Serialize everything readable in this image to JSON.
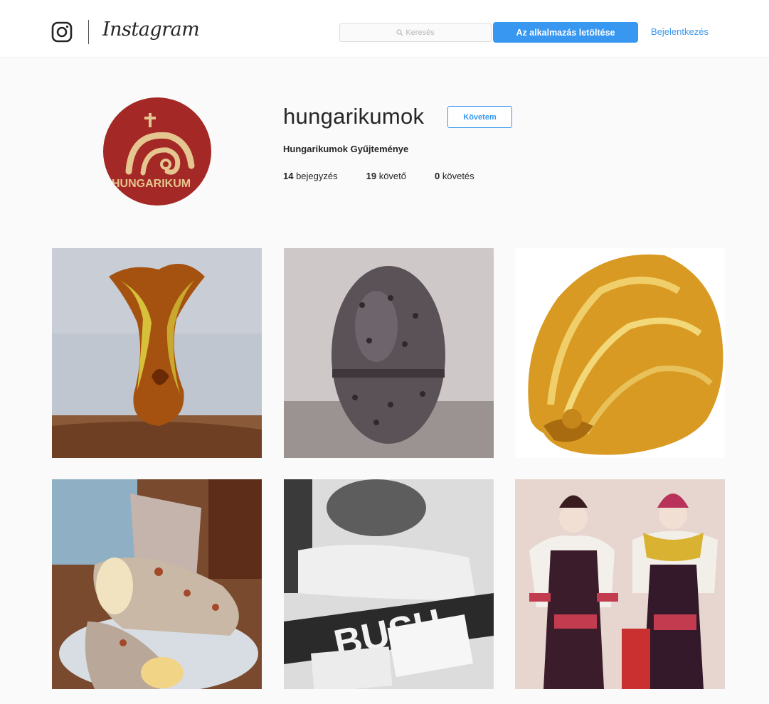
{
  "nav": {
    "brand": "Instagram",
    "search_placeholder": "Keresés",
    "download_label": "Az alkalmazás letöltése",
    "login_label": "Bejelentkezés"
  },
  "profile": {
    "username": "hungarikumok",
    "follow_label": "Követem",
    "full_name": "Hungarikumok Gyűjteménye",
    "avatar_logo_text": "HUNGARIKUM",
    "stats": [
      {
        "count": "14",
        "label": "bejegyzés"
      },
      {
        "count": "19",
        "label": "követő"
      },
      {
        "count": "0",
        "label": "követés"
      }
    ]
  },
  "posts": [
    {
      "subject": "amber glass vase"
    },
    {
      "subject": "dark ceramic egg"
    },
    {
      "subject": "golden shell bowl"
    },
    {
      "subject": "chimney cakes"
    },
    {
      "subject": "black and white photo"
    },
    {
      "subject": "folk costume dolls"
    }
  ],
  "colors": {
    "accent": "#3897f0",
    "avatar_bg": "#a42825",
    "avatar_logo": "#e5c590"
  },
  "icons": {
    "logo": "instagram-camera-icon",
    "search": "search-icon"
  }
}
